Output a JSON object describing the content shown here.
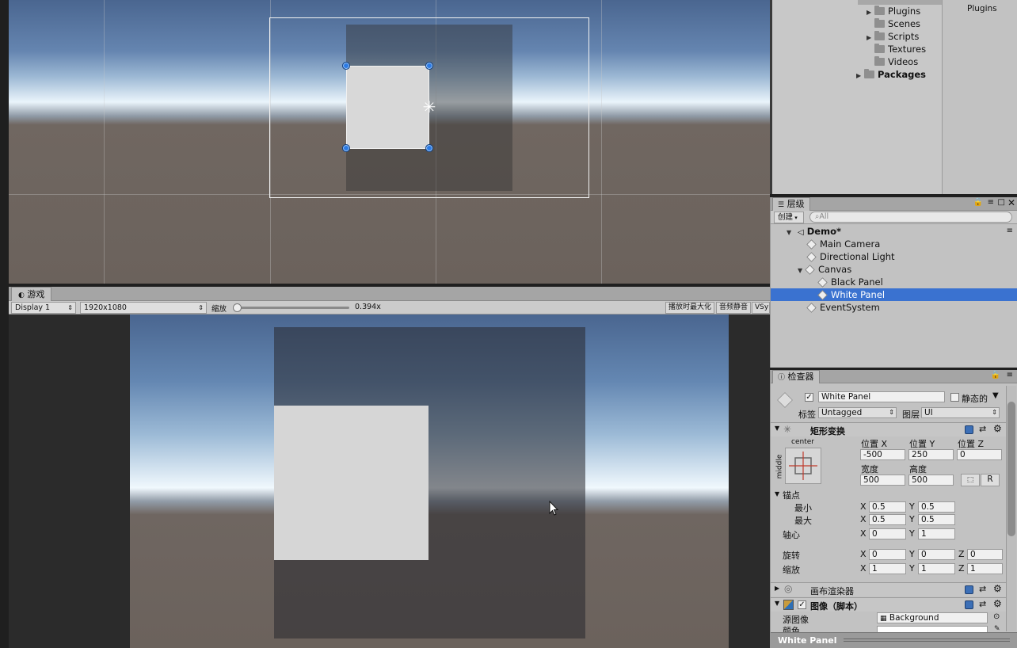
{
  "project": {
    "folders": [
      {
        "label": "Plugins",
        "expandable": true
      },
      {
        "label": "Scenes",
        "expandable": false
      },
      {
        "label": "Scripts",
        "expandable": true
      },
      {
        "label": "Textures",
        "expandable": false
      },
      {
        "label": "Videos",
        "expandable": false
      }
    ],
    "packages_label": "Packages",
    "content_label": "Plugins"
  },
  "game": {
    "tab_label": "游戏",
    "display": "Display 1",
    "resolution": "1920x1080",
    "scale_label": "缩放",
    "scale_value": "0.394x",
    "maximize_on_play": "播放时最大化",
    "mute_audio": "音频静音",
    "vsync": "VSyn",
    "slider_fraction": 0.03
  },
  "hierarchy": {
    "tab_label": "层级",
    "create_label": "创建",
    "search_placeholder": "All",
    "scene_name": "Demo*",
    "items": [
      {
        "label": "Main Camera",
        "depth": 1
      },
      {
        "label": "Directional Light",
        "depth": 1
      },
      {
        "label": "Canvas",
        "depth": 1
      },
      {
        "label": "Black Panel",
        "depth": 2
      },
      {
        "label": "White Panel",
        "depth": 2
      },
      {
        "label": "EventSystem",
        "depth": 1
      }
    ],
    "selected": "White Panel"
  },
  "inspector": {
    "tab_label": "检查器",
    "object_name": "White Panel",
    "static_label": "静态的",
    "tag_label": "标签",
    "tag_value": "Untagged",
    "layer_label": "图层",
    "layer_value": "UI",
    "rect_transform": {
      "title": "矩形变换",
      "anchor_h": "center",
      "anchor_v": "middle",
      "pos_x_label": "位置 X",
      "pos_y_label": "位置 Y",
      "pos_z_label": "位置 Z",
      "pos_x": "-500",
      "pos_y": "250",
      "pos_z": "0",
      "width_label": "宽度",
      "height_label": "高度",
      "width": "500",
      "height": "500",
      "raw_button": "R",
      "anchors_label": "锚点",
      "min_label": "最小",
      "max_label": "最大",
      "min_x": "0.5",
      "min_y": "0.5",
      "max_x": "0.5",
      "max_y": "0.5",
      "pivot_label": "轴心",
      "pivot_x": "0",
      "pivot_y": "1",
      "rotation_label": "旋转",
      "rot_x": "0",
      "rot_y": "0",
      "rot_z": "0",
      "scale_label": "缩放",
      "scale_x": "1",
      "scale_y": "1",
      "scale_z": "1",
      "axis_x": "X",
      "axis_y": "Y",
      "axis_z": "Z"
    },
    "canvas_renderer_title": "画布渲染器",
    "image_title": "图像（脚本）",
    "source_image_label": "源图像",
    "source_image_value": "Background",
    "color_label": "颜色",
    "bottom_label": "White Panel"
  }
}
